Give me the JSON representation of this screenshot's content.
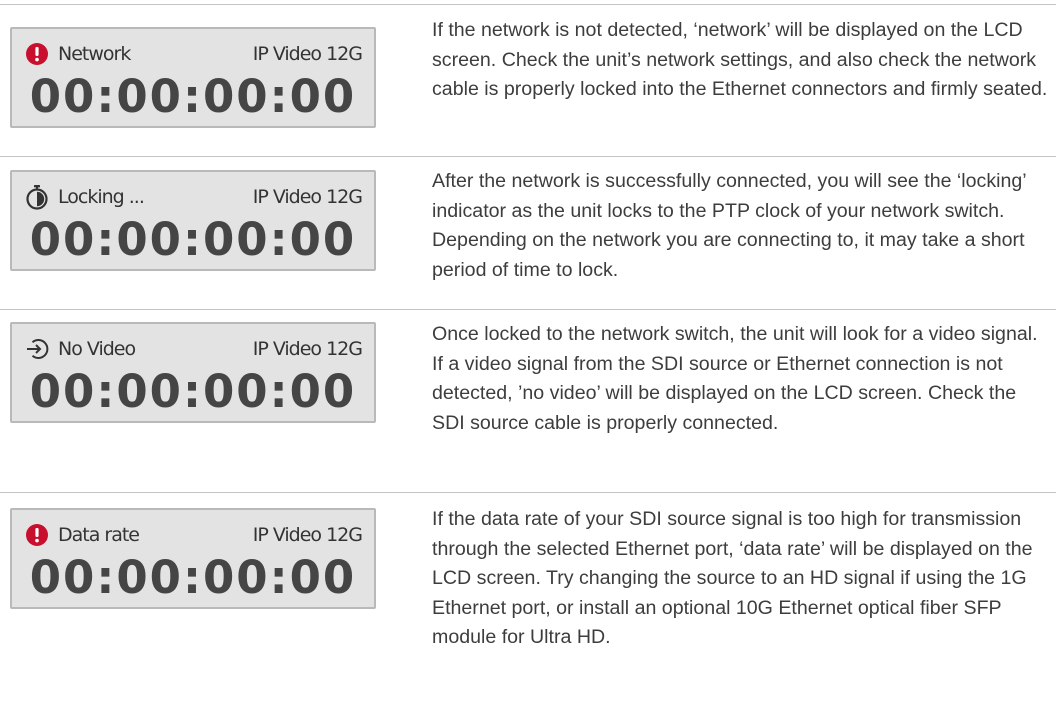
{
  "sections": [
    {
      "icon": "alert-icon",
      "icon_color": "#c8102e",
      "status": "Network",
      "model": "IP Video 12G",
      "timecode": "00:00:00:00",
      "description": "If the network is not detected, ‘network’ will be displayed on the LCD screen. Check the unit’s network settings, and also check the network cable is properly locked into the Ethernet connectors and firmly seated."
    },
    {
      "icon": "stopwatch-icon",
      "icon_color": "#333333",
      "status": "Locking ...",
      "model": "IP Video 12G",
      "timecode": "00:00:00:00",
      "description": "After the network is successfully connected, you will see the ‘locking’ indicator as the unit locks to the PTP clock of your network switch. Depending on the network you are connecting to, it may take a short period of time to lock."
    },
    {
      "icon": "input-arrow-icon",
      "icon_color": "#333333",
      "status": "No Video",
      "model": "IP Video 12G",
      "timecode": "00:00:00:00",
      "description": "Once locked to the network switch, the unit will look for a video signal. If a video signal from the SDI source or Ethernet connection is not detected, ’no video’ will be displayed on the LCD screen. Check the SDI source cable is properly connected."
    },
    {
      "icon": "alert-icon",
      "icon_color": "#c8102e",
      "status": "Data rate",
      "model": "IP Video 12G",
      "timecode": "00:00:00:00",
      "description": "If the data rate of your SDI source signal is too high for transmission through the selected Ethernet port, ‘data rate’ will be displayed on the LCD screen. Try changing the source to an HD signal if using the 1G Ethernet port, or install an optional 10G Ethernet optical fiber SFP module for Ultra HD."
    }
  ]
}
